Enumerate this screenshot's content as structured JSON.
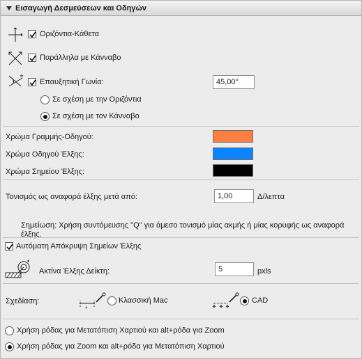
{
  "panel": {
    "title": "Εισαγωγή Δεσμεύσεων και Οδηγών"
  },
  "constraints": {
    "horizontal_vertical": {
      "label": "Οριζόντια-Κάθετα",
      "checked": true
    },
    "parallel_grid": {
      "label": "Παράλληλα με Κάνναβο",
      "checked": true
    },
    "incremental_angle": {
      "label": "Επαυξητική Γωνία:",
      "checked": true,
      "value": "45,00°"
    },
    "relative_horizontal": {
      "label": "Σε σχέση με την Οριζόντια",
      "selected": false
    },
    "relative_grid": {
      "label": "Σε σχέση με τον Κάνναβο",
      "selected": true
    }
  },
  "colors": {
    "guide_line": {
      "label": "Χρώμα Γραμμής-Οδηγού:",
      "color": "#ff7f41"
    },
    "snap_guide": {
      "label": "Χρώμα Οδηγού Έλξης:",
      "color": "#0a84ff"
    },
    "snap_point": {
      "label": "Χρώμα Σημείου Έλξης:",
      "color": "#000000"
    }
  },
  "snap_tone": {
    "label": "Τονισμός ως αναφορά έλξης μετά από:",
    "value": "1,00",
    "unit": "Δ/λεπτα"
  },
  "note": "Σημείωση: Χρήση συντόμευσης \"Q\" για άμεσο τονισμό μίας ακμής ή μίας κορυφής ως αναφορά έλξης.",
  "auto_hide": {
    "label": "Αυτόματη Απόκρυψη Σημείων Έλξης",
    "checked": true
  },
  "cursor_radius": {
    "label": "Ακτίνα Έλξης Δείκτη:",
    "value": "5",
    "unit": "pxls"
  },
  "drawing": {
    "label": "Σχεδίαση:",
    "classic_mac": {
      "label": "Κλασσική Mac",
      "selected": false
    },
    "cad": {
      "label": "CAD",
      "selected": true
    }
  },
  "wheel": {
    "pan_option": {
      "label": "Χρήση ρόδας για Μετατόπιση Χαρτιού και alt+ρόδα για Zoom",
      "selected": false
    },
    "zoom_option": {
      "label": "Χρήση ρόδας για Zoom και alt+ρόδα για Μετατόπιση Χαρτιού",
      "selected": true
    }
  },
  "icons": {
    "orthogonal": "crosshair-arrows-icon",
    "parallel": "diagonal-cross-icon",
    "angle": "angle-arrows-icon",
    "radius": "snap-radius-icon",
    "classic": "classic-drag-icon",
    "cad": "cad-drag-icon"
  }
}
